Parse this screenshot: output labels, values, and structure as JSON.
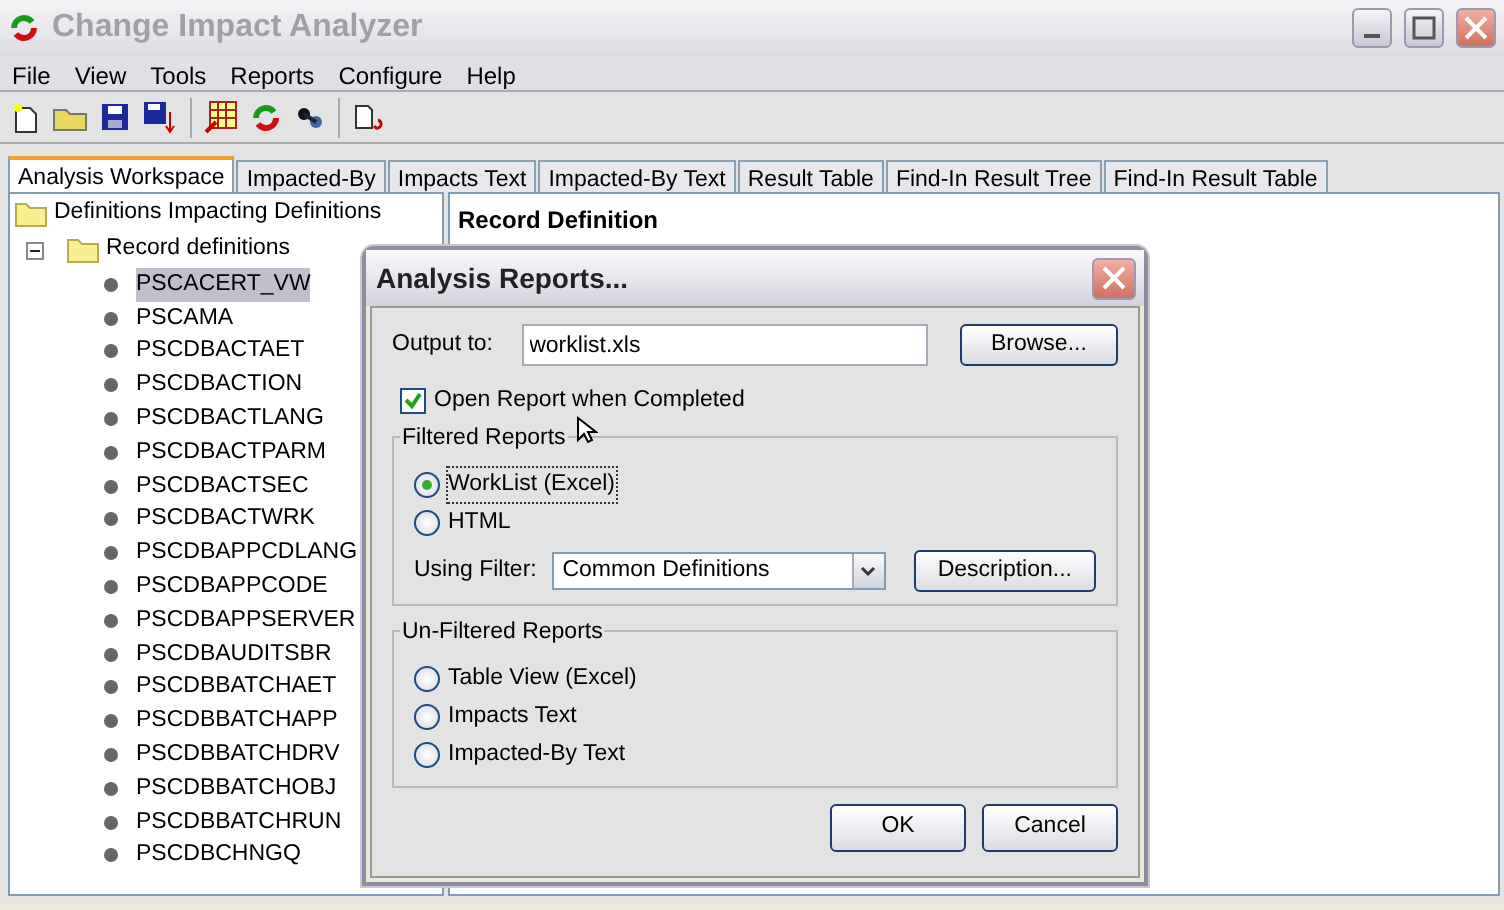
{
  "window": {
    "title": "Change Impact Analyzer"
  },
  "menu": [
    "File",
    "View",
    "Tools",
    "Reports",
    "Configure",
    "Help"
  ],
  "tabs": [
    {
      "label": "Analysis Workspace",
      "selected": true
    },
    {
      "label": "Impacted-By",
      "selected": false
    },
    {
      "label": "Impacts Text",
      "selected": false
    },
    {
      "label": "Impacted-By Text",
      "selected": false
    },
    {
      "label": "Result Table",
      "selected": false
    },
    {
      "label": "Find-In Result Tree",
      "selected": false
    },
    {
      "label": "Find-In Result Table",
      "selected": false
    }
  ],
  "tree": [
    {
      "label": "Definitions Impacting Definitions",
      "children": [
        {
          "label": "Record definitions",
          "expanded": true,
          "children": [
            {
              "label": "PSCACERT_VW",
              "selected": true
            },
            {
              "label": "PSCAMA",
              "selected": false
            },
            {
              "label": "PSCDBACTAET",
              "selected": false
            },
            {
              "label": "PSCDBACTION",
              "selected": false
            },
            {
              "label": "PSCDBACTLANG",
              "selected": false
            },
            {
              "label": "PSCDBACTPARM",
              "selected": false
            },
            {
              "label": "PSCDBACTSEC",
              "selected": false
            },
            {
              "label": "PSCDBACTWRK",
              "selected": false
            },
            {
              "label": "PSCDBAPPCDLANG",
              "selected": false
            },
            {
              "label": "PSCDBAPPCODE",
              "selected": false
            },
            {
              "label": "PSCDBAPPSERVER",
              "selected": false
            },
            {
              "label": "PSCDBAUDITSBR",
              "selected": false
            },
            {
              "label": "PSCDBBATCHAET",
              "selected": false
            },
            {
              "label": "PSCDBBATCHAPP",
              "selected": false
            },
            {
              "label": "PSCDBBATCHDRV",
              "selected": false
            },
            {
              "label": "PSCDBBATCHOBJ",
              "selected": false
            },
            {
              "label": "PSCDBBATCHRUN",
              "selected": false
            },
            {
              "label": "PSCDBCHNGQ",
              "selected": false
            }
          ]
        }
      ]
    }
  ],
  "detail_panel": {
    "heading": "Record Definition"
  },
  "dialog": {
    "title": "Analysis Reports...",
    "output_label": "Output to:",
    "output_value": "worklist.xls",
    "browse_button": "Browse...",
    "open_report": {
      "label": "Open Report when Completed",
      "checked": true
    },
    "filtered": {
      "legend": "Filtered Reports",
      "options": [
        {
          "label": "WorkList (Excel)",
          "selected": true
        },
        {
          "label": "HTML",
          "selected": false
        }
      ],
      "filter_label": "Using Filter:",
      "filter_value": "Common Definitions",
      "description_button": "Description..."
    },
    "unfiltered": {
      "legend": "Un-Filtered Reports",
      "options": [
        {
          "label": "Table View (Excel)",
          "selected": false
        },
        {
          "label": "Impacts Text",
          "selected": false
        },
        {
          "label": "Impacted-By Text",
          "selected": false
        }
      ]
    },
    "buttons": [
      "OK",
      "Cancel"
    ]
  }
}
